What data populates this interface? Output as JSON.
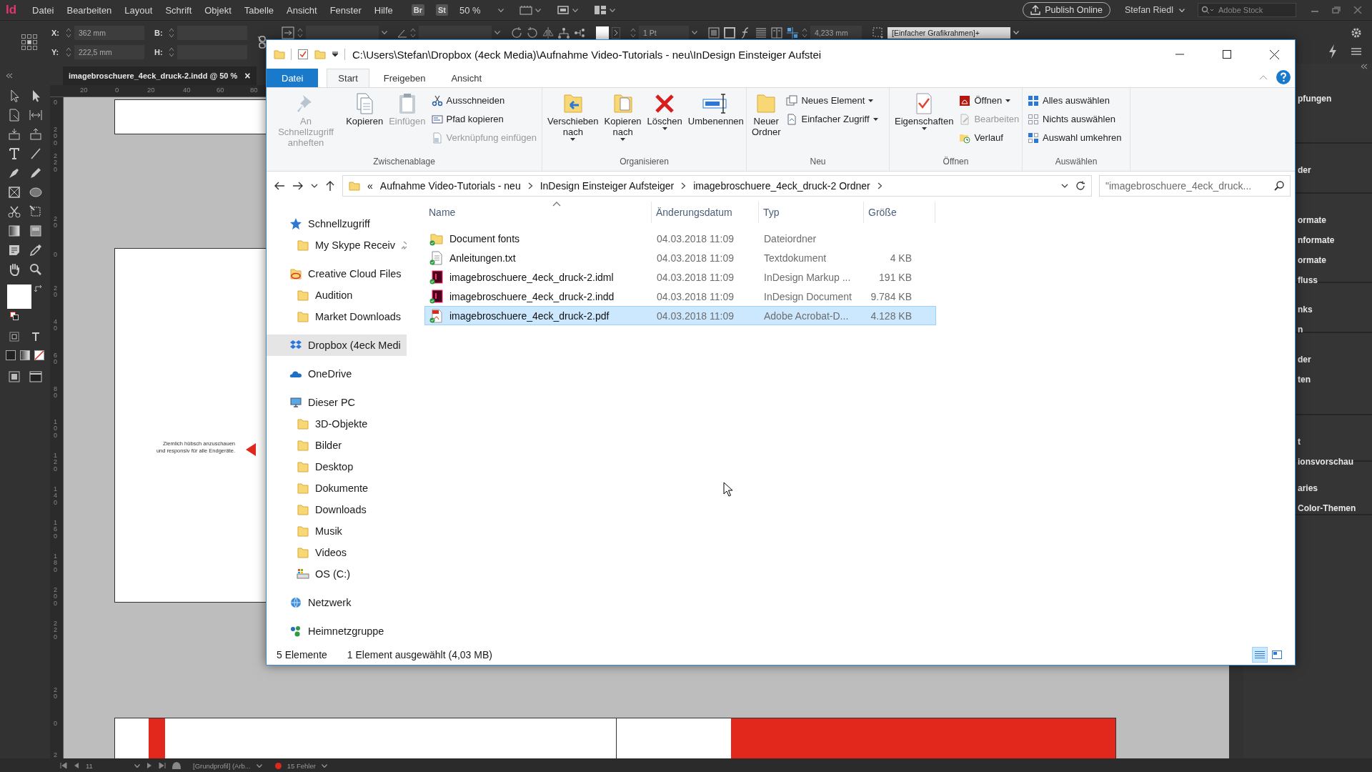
{
  "app": {
    "logo": "Id",
    "menu": [
      "Datei",
      "Bearbeiten",
      "Layout",
      "Schrift",
      "Objekt",
      "Tabelle",
      "Ansicht",
      "Fenster",
      "Hilfe"
    ],
    "bridge": "Br",
    "stock": "St",
    "zoom": "50 %",
    "publish": "Publish Online",
    "user": "Stefan Riedl",
    "search_placeholder": "Adobe Stock"
  },
  "control_bar": {
    "x_label": "X:",
    "x": "362 mm",
    "y_label": "Y:",
    "y": "222,5 mm",
    "w_label": "B:",
    "h_label": "H:",
    "stroke": "1 Pt",
    "spacing": "4,233 mm",
    "object_style": "[Einfacher Grafikrahmen]+"
  },
  "document_tab": {
    "title": "imagebroschuere_4eck_druck-2.indd @ 50 %",
    "close": "×"
  },
  "ruler_h": [
    "20",
    "0",
    "20",
    "40",
    "60",
    "80"
  ],
  "ruler_v": [
    "0",
    "200",
    "220",
    "20",
    "0",
    "20",
    "40",
    "60",
    "80",
    "100",
    "120",
    "140",
    "160",
    "180",
    "200",
    "220",
    "20",
    "0",
    "2"
  ],
  "canvas": {
    "caption": [
      "Ziemlich hübsch anzuschauen",
      "und responsiv für alle Endgeräte."
    ]
  },
  "panels": [
    {
      "items": [
        "pfungen"
      ]
    },
    {
      "items": [
        "der"
      ]
    },
    {
      "items": [
        "ormate",
        "nformate",
        "ormate",
        "fluss"
      ]
    },
    {
      "items": [
        "nks",
        "n"
      ]
    },
    {
      "items": [
        "der",
        "ten"
      ]
    },
    {
      "items": [
        "t",
        "ionsvorschau"
      ]
    },
    {
      "items": [
        "aries",
        "Color-Themen"
      ]
    }
  ],
  "status_bar": {
    "page": "11",
    "profile": "[Grundprofil] (Arb...",
    "errors": "15 Fehler"
  },
  "explorer": {
    "title_path": "C:\\Users\\Stefan\\Dropbox (4eck Media)\\Aufnahme Video-Tutorials - neu\\InDesign Einsteiger Aufstei",
    "ribbon_tabs": [
      {
        "label": "Datei",
        "kind": "file",
        "selected": false
      },
      {
        "label": "Start",
        "kind": "tab",
        "selected": true
      },
      {
        "label": "Freigeben",
        "kind": "tab",
        "selected": false
      },
      {
        "label": "Ansicht",
        "kind": "tab",
        "selected": false
      }
    ],
    "ribbon_groups": [
      {
        "label": "Zwischenablage",
        "commands": [
          {
            "lines": [
              "An Schnellzugriff",
              "anheften"
            ],
            "kind": "large",
            "disabled": true,
            "dropdown": false
          },
          {
            "lines": [
              "Kopieren"
            ],
            "kind": "large",
            "disabled": false,
            "dropdown": false
          },
          {
            "lines": [
              "Einfügen"
            ],
            "kind": "large",
            "disabled": true,
            "dropdown": false
          },
          {
            "lines": [
              "Ausschneiden"
            ],
            "kind": "small",
            "disabled": false,
            "dropdown": false
          },
          {
            "lines": [
              "Pfad kopieren"
            ],
            "kind": "small",
            "disabled": false,
            "dropdown": false
          },
          {
            "lines": [
              "Verknüpfung einfügen"
            ],
            "kind": "small",
            "disabled": true,
            "dropdown": false
          }
        ]
      },
      {
        "label": "Organisieren",
        "commands": [
          {
            "lines": [
              "Verschieben",
              "nach"
            ],
            "kind": "large",
            "disabled": false,
            "dropdown": true
          },
          {
            "lines": [
              "Kopieren",
              "nach"
            ],
            "kind": "large",
            "disabled": false,
            "dropdown": true
          },
          {
            "lines": [
              "Löschen"
            ],
            "kind": "large",
            "disabled": false,
            "dropdown": true
          },
          {
            "lines": [
              "Umbenennen"
            ],
            "kind": "large",
            "disabled": false,
            "dropdown": false
          }
        ]
      },
      {
        "label": "Neu",
        "commands": [
          {
            "lines": [
              "Neuer",
              "Ordner"
            ],
            "kind": "large",
            "disabled": false,
            "dropdown": false
          },
          {
            "lines": [
              "Neues Element"
            ],
            "kind": "small",
            "disabled": false,
            "dropdown": true
          },
          {
            "lines": [
              "Einfacher Zugriff"
            ],
            "kind": "small",
            "disabled": false,
            "dropdown": true
          }
        ]
      },
      {
        "label": "Öffnen",
        "commands": [
          {
            "lines": [
              "Eigenschaften"
            ],
            "kind": "large",
            "disabled": false,
            "dropdown": true
          },
          {
            "lines": [
              "Öffnen"
            ],
            "kind": "small",
            "disabled": false,
            "dropdown": true
          },
          {
            "lines": [
              "Bearbeiten"
            ],
            "kind": "small",
            "disabled": true,
            "dropdown": false
          },
          {
            "lines": [
              "Verlauf"
            ],
            "kind": "small",
            "disabled": false,
            "dropdown": false
          }
        ]
      },
      {
        "label": "Auswählen",
        "commands": [
          {
            "lines": [
              "Alles auswählen"
            ],
            "kind": "small",
            "disabled": false,
            "dropdown": false
          },
          {
            "lines": [
              "Nichts auswählen"
            ],
            "kind": "small",
            "disabled": false,
            "dropdown": false
          },
          {
            "lines": [
              "Auswahl umkehren"
            ],
            "kind": "small",
            "disabled": false,
            "dropdown": false
          }
        ]
      }
    ],
    "address": {
      "overflow": "«",
      "crumbs": [
        "Aufnahme Video-Tutorials - neu",
        "InDesign Einsteiger Aufsteiger",
        "imagebroschuere_4eck_druck-2 Ordner"
      ]
    },
    "search": {
      "placeholder": "\"imagebroschuere_4eck_druck..."
    },
    "nav": [
      {
        "label": "Schnellzugriff",
        "kind": "quick-access",
        "selected": false,
        "children": [
          {
            "label": "My Skype Receiv",
            "kind": "folder",
            "selected": false,
            "pinned": true
          }
        ]
      },
      {
        "label": "Creative Cloud Files",
        "kind": "creative-cloud",
        "selected": false,
        "children": [
          {
            "label": "Audition",
            "kind": "folder",
            "selected": false
          },
          {
            "label": "Market Downloads",
            "kind": "folder",
            "selected": false
          }
        ]
      },
      {
        "label": "Dropbox (4eck Medi",
        "kind": "dropbox",
        "selected": true
      },
      {
        "label": "OneDrive",
        "kind": "onedrive",
        "selected": false
      },
      {
        "label": "Dieser PC",
        "kind": "pc",
        "selected": false,
        "children": [
          {
            "label": "3D-Objekte",
            "kind": "folder",
            "selected": false
          },
          {
            "label": "Bilder",
            "kind": "folder",
            "selected": false
          },
          {
            "label": "Desktop",
            "kind": "folder",
            "selected": false
          },
          {
            "label": "Dokumente",
            "kind": "folder",
            "selected": false
          },
          {
            "label": "Downloads",
            "kind": "folder",
            "selected": false
          },
          {
            "label": "Musik",
            "kind": "folder",
            "selected": false
          },
          {
            "label": "Videos",
            "kind": "folder",
            "selected": false
          },
          {
            "label": "OS (C:)",
            "kind": "drive",
            "selected": false
          }
        ]
      },
      {
        "label": "Netzwerk",
        "kind": "network",
        "selected": false
      },
      {
        "label": "Heimnetzgruppe",
        "kind": "homegroup",
        "selected": false
      }
    ],
    "columns": [
      {
        "label": "Name",
        "sorted": true
      },
      {
        "label": "Änderungsdatum",
        "sorted": false
      },
      {
        "label": "Typ",
        "sorted": false
      },
      {
        "label": "Größe",
        "sorted": false
      }
    ],
    "files": [
      {
        "name": "Document fonts",
        "date": "04.03.2018 11:09",
        "type": "Dateiordner",
        "kind": "folder",
        "selected": false
      },
      {
        "name": "Anleitungen.txt",
        "date": "04.03.2018 11:09",
        "type": "Textdokument",
        "size": "4 KB",
        "kind": "text",
        "selected": false
      },
      {
        "name": "imagebroschuere_4eck_druck-2.idml",
        "date": "04.03.2018 11:09",
        "type": "InDesign Markup ...",
        "size": "191 KB",
        "kind": "indesign",
        "selected": false
      },
      {
        "name": "imagebroschuere_4eck_druck-2.indd",
        "date": "04.03.2018 11:09",
        "type": "InDesign Document",
        "size": "9.784 KB",
        "kind": "indesign",
        "selected": false
      },
      {
        "name": "imagebroschuere_4eck_druck-2.pdf",
        "date": "04.03.2018 11:09",
        "type": "Adobe Acrobat-D...",
        "size": "4.128 KB",
        "kind": "pdf",
        "selected": true
      }
    ],
    "status": {
      "count": "5 Elemente",
      "selection": "1 Element ausgewählt (4,03 MB)"
    },
    "views": [
      {
        "selected": true
      },
      {
        "selected": false
      }
    ]
  }
}
